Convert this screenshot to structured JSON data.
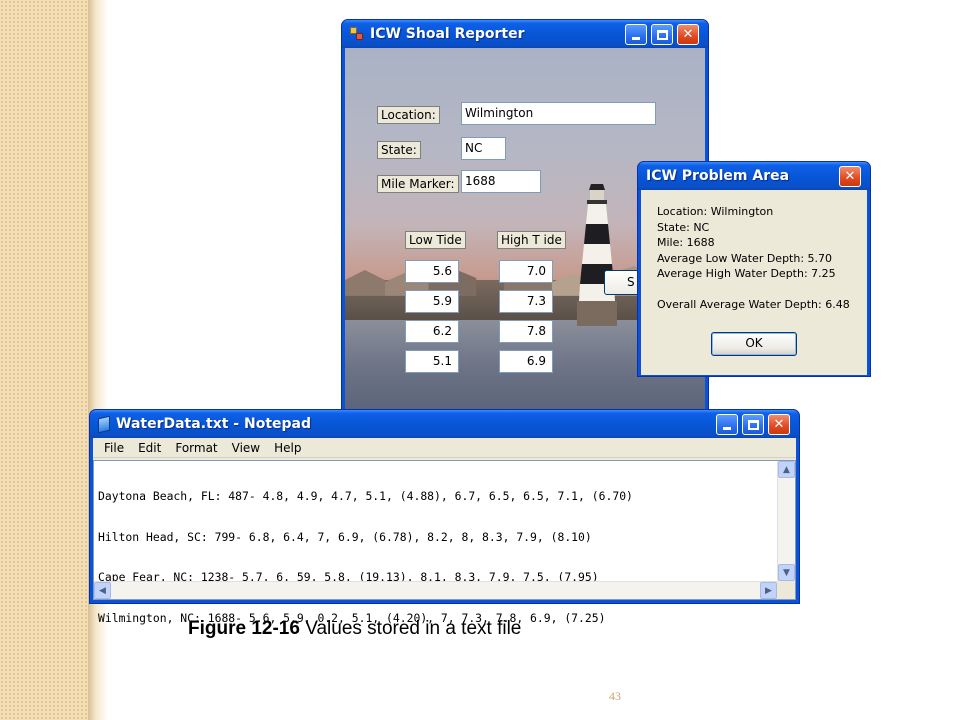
{
  "shoal_window": {
    "title": "ICW Shoal Reporter",
    "location_label": "Location:",
    "location_value": "Wilmington",
    "state_label": "State:",
    "state_value": "NC",
    "mile_label": "Mile Marker:",
    "mile_value": "1688",
    "low_tide_label": "Low Tide",
    "high_tide_label": "High T ide",
    "low_values": [
      "5.6",
      "5.9",
      "6.2",
      "5.1"
    ],
    "high_values": [
      "7.0",
      "7.3",
      "7.8",
      "6.9"
    ],
    "partial_button_label": "S"
  },
  "problem_dialog": {
    "title": "ICW Problem Area",
    "lines": [
      "Location: Wilmington",
      "State: NC",
      "Mile: 1688",
      "Average Low Water Depth: 5.70",
      "Average High Water Depth: 7.25",
      "",
      "Overall Average Water Depth: 6.48"
    ],
    "ok_label": "OK"
  },
  "notepad": {
    "title": "WaterData.txt - Notepad",
    "menu": [
      "File",
      "Edit",
      "Format",
      "View",
      "Help"
    ],
    "lines": [
      "Daytona Beach, FL: 487- 4.8, 4.9, 4.7, 5.1, (4.88), 6.7, 6.5, 6.5, 7.1, (6.70)",
      "Hilton Head, SC: 799- 6.8, 6.4, 7, 6.9, (6.78), 8.2, 8, 8.3, 7.9, (8.10)",
      "Cape Fear, NC: 1238- 5.7, 6, 59, 5.8, (19.13), 8.1, 8.3, 7.9, 7.5, (7.95)",
      "Wilmington, NC: 1688- 5.6, 5.9, 0.2, 5.1, (4.20), 7, 7.3, 7.8, 6.9, (7.25)"
    ]
  },
  "caption": {
    "figure": "Figure 12-16",
    "text": " Values stored in a text file"
  },
  "page_number": "43",
  "colors": {
    "xp_blue": "#0a53d8",
    "dialog_face": "#ece9d8",
    "close_red": "#df4a22",
    "page_number": "#c9a66b"
  }
}
